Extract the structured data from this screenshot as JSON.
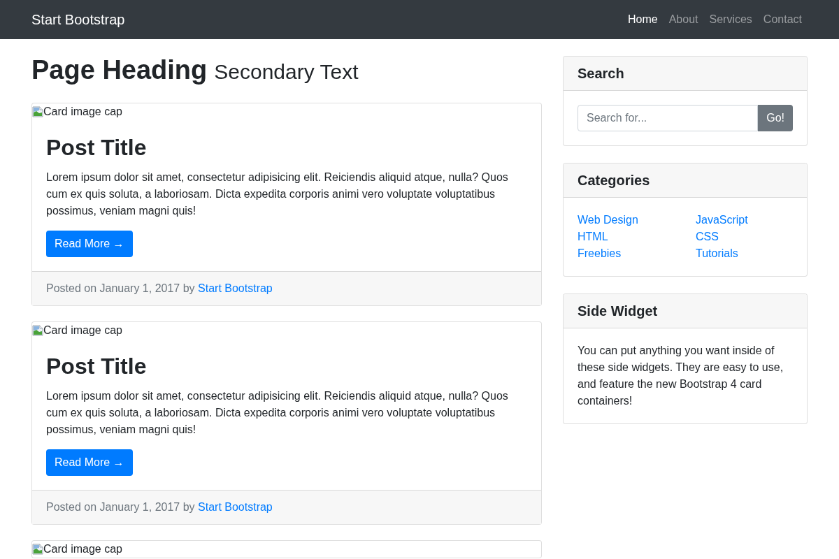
{
  "navbar": {
    "brand": "Start Bootstrap",
    "links": [
      {
        "label": "Home",
        "selected": true
      },
      {
        "label": "About",
        "selected": false
      },
      {
        "label": "Services",
        "selected": false
      },
      {
        "label": "Contact",
        "selected": false
      }
    ]
  },
  "page_heading": {
    "title": "Page Heading",
    "subtitle": "Secondary Text"
  },
  "posts": [
    {
      "image_alt": "Card image cap",
      "title": "Post Title",
      "excerpt": "Lorem ipsum dolor sit amet, consectetur adipisicing elit. Reiciendis aliquid atque, nulla? Quos cum ex quis soluta, a laboriosam. Dicta expedita corporis animi vero voluptate voluptatibus possimus, veniam magni quis!",
      "button": "Read More →",
      "footer": {
        "text": "Posted on January 1, 2017 by",
        "author": "Start Bootstrap"
      }
    },
    {
      "image_alt": "Card image cap",
      "title": "Post Title",
      "excerpt": "Lorem ipsum dolor sit amet, consectetur adipisicing elit. Reiciendis aliquid atque, nulla? Quos cum ex quis soluta, a laboriosam. Dicta expedita corporis animi vero voluptate voluptatibus possimus, veniam magni quis!",
      "button": "Read More →",
      "footer": {
        "text": "Posted on January 1, 2017 by",
        "author": "Start Bootstrap"
      }
    },
    {
      "image_alt": "Card image cap"
    }
  ],
  "sidebar": {
    "search": {
      "title": "Search",
      "placeholder": "Search for...",
      "button": "Go!"
    },
    "categories": {
      "title": "Categories",
      "columns": [
        [
          "Web Design",
          "HTML",
          "Freebies"
        ],
        [
          "JavaScript",
          "CSS",
          "Tutorials"
        ]
      ]
    },
    "widget": {
      "title": "Side Widget",
      "text": "You can put anything you want inside of these side widgets. They are easy to use, and feature the new Bootstrap 4 card containers!"
    }
  }
}
